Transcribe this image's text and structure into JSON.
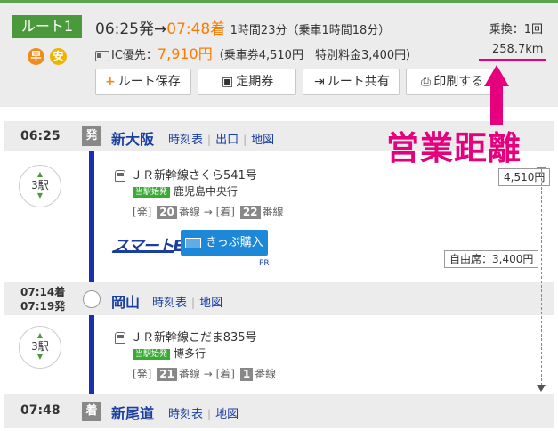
{
  "header": {
    "route_label": "ルート1",
    "tags": [
      {
        "text": "早",
        "color": "#f08c1e"
      },
      {
        "text": "安",
        "color": "#f0b400"
      }
    ],
    "dep_time": "06:25発",
    "arrow": "→",
    "arr_time": "07:48着",
    "duration": "1時間23分（乗車1時間18分）",
    "transfers": "乗換：1回",
    "ic_label": "IC優先：",
    "fare_total": "7,910円",
    "fare_detail": "（乗車券4,510円　特別料金3,400円）",
    "distance": "258.7km"
  },
  "actions": {
    "save": "ルート保存",
    "pass": "定期券",
    "share": "ルート共有",
    "print": "印刷する"
  },
  "annotation": {
    "text": "営業距離",
    "color": "#e6007e"
  },
  "stations": [
    {
      "time": "06:25",
      "badge": "発",
      "name": "新大阪",
      "links": [
        "時刻表",
        "出口",
        "地図"
      ]
    },
    {
      "time_arr": "07:14着",
      "time_dep": "07:19発",
      "name": "岡山",
      "links": [
        "時刻表",
        "地図"
      ]
    },
    {
      "time": "07:48",
      "badge": "着",
      "name": "新尾道",
      "links": [
        "時刻表",
        "地図"
      ]
    }
  ],
  "segments": [
    {
      "stops": "3駅",
      "train": "ＪＲ新幹線さくら541号",
      "origin_badge": "当駅始発",
      "destination": "鹿児島中央行",
      "dep_label": "[発]",
      "dep_track": "20",
      "track_suffix": "番線",
      "arr_label": "[着]",
      "arr_track": "22"
    },
    {
      "stops": "3駅",
      "train": "ＪＲ新幹線こだま835号",
      "origin_badge": "当駅始発",
      "destination": "博多行",
      "dep_label": "[発]",
      "dep_track": "21",
      "track_suffix": "番線",
      "arr_label": "[着]",
      "arr_track": "1"
    }
  ],
  "promo": {
    "smartex": "スマートEX",
    "ticket_button": "きっぷ購入",
    "pr": "PR"
  },
  "fares": {
    "base": "4,510円",
    "seat": "自由席：3,400円"
  },
  "colors": {
    "route_green": "#4a9a3b",
    "line_blue": "#1a2fb0",
    "link_blue": "#1a3fa0",
    "accent_orange": "#ff7a00"
  }
}
